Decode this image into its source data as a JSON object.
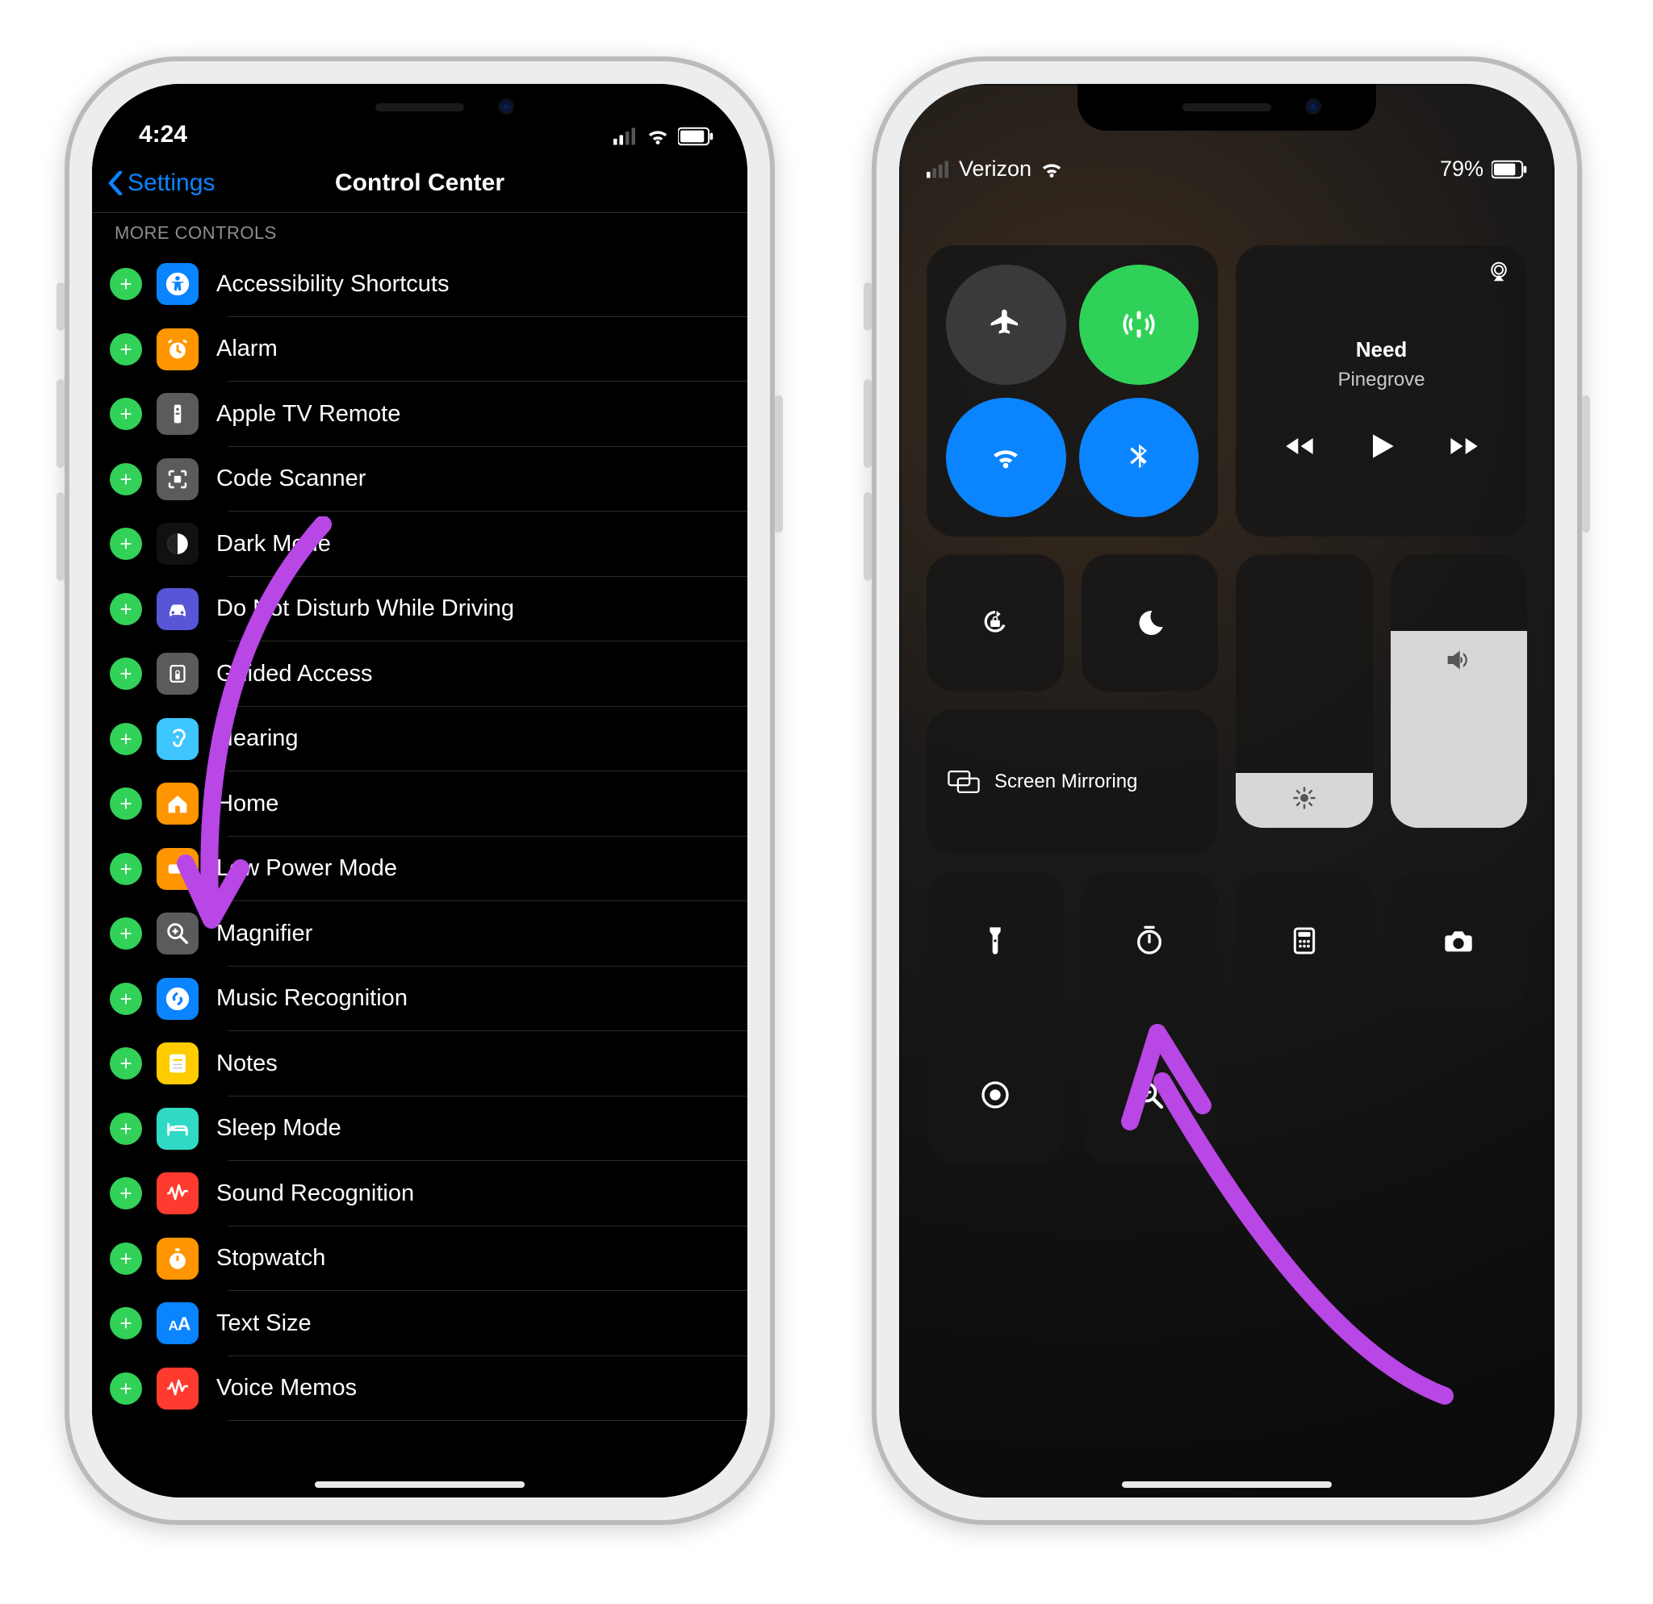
{
  "left": {
    "status_time": "4:24",
    "nav_back": "Settings",
    "title": "Control Center",
    "section": "MORE CONTROLS",
    "items": [
      {
        "label": "Accessibility Shortcuts",
        "iconColor": "#0a84ff",
        "glyph": "access"
      },
      {
        "label": "Alarm",
        "iconColor": "#ff9500",
        "glyph": "alarm"
      },
      {
        "label": "Apple TV Remote",
        "iconColor": "#5b5b5d",
        "glyph": "remote"
      },
      {
        "label": "Code Scanner",
        "iconColor": "#5b5b5d",
        "glyph": "scan"
      },
      {
        "label": "Dark Mode",
        "iconColor": "#111",
        "glyph": "dark"
      },
      {
        "label": "Do Not Disturb While Driving",
        "iconColor": "#5856d6",
        "glyph": "car"
      },
      {
        "label": "Guided Access",
        "iconColor": "#5b5b5d",
        "glyph": "lock"
      },
      {
        "label": "Hearing",
        "iconColor": "#3ec6ff",
        "glyph": "ear"
      },
      {
        "label": "Home",
        "iconColor": "#ff9500",
        "glyph": "home"
      },
      {
        "label": "Low Power Mode",
        "iconColor": "#ff9500",
        "glyph": "battery"
      },
      {
        "label": "Magnifier",
        "iconColor": "#5b5b5d",
        "glyph": "magnify"
      },
      {
        "label": "Music Recognition",
        "iconColor": "#0a84ff",
        "glyph": "shazam"
      },
      {
        "label": "Notes",
        "iconColor": "#ffcc00",
        "glyph": "notes"
      },
      {
        "label": "Sleep Mode",
        "iconColor": "#2fd9c4",
        "glyph": "bed"
      },
      {
        "label": "Sound Recognition",
        "iconColor": "#ff3b30",
        "glyph": "wave"
      },
      {
        "label": "Stopwatch",
        "iconColor": "#ff9500",
        "glyph": "stopwatch"
      },
      {
        "label": "Text Size",
        "iconColor": "#0a84ff",
        "glyph": "text"
      },
      {
        "label": "Voice Memos",
        "iconColor": "#ff3b30",
        "glyph": "voice"
      }
    ]
  },
  "right": {
    "carrier": "Verizon",
    "battery": "79%",
    "music": {
      "title": "Need",
      "artist": "Pinegrove"
    },
    "screen_mirroring_label": "Screen Mirroring"
  }
}
